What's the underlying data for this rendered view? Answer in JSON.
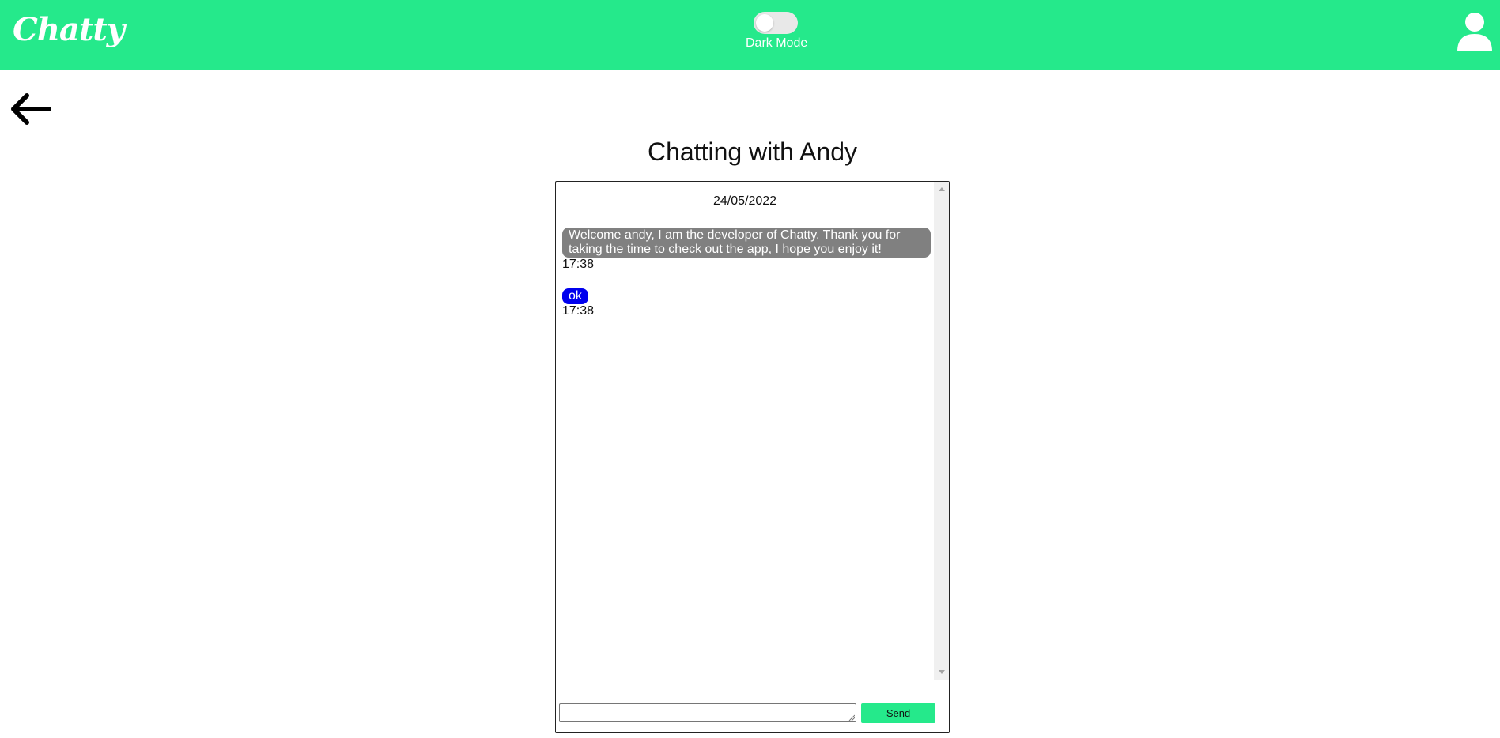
{
  "header": {
    "logo": "Chatty",
    "dark_mode_label": "Dark Mode",
    "dark_mode_on": false,
    "brand_color": "#25e98b",
    "user_icon": "user-icon"
  },
  "nav": {
    "back_icon": "arrow-left-icon"
  },
  "chat": {
    "title": "Chatting with Andy",
    "date": "24/05/2022",
    "messages": [
      {
        "text": "Welcome andy, I am the developer of Chatty. Thank you for taking the time to check out the app, I hope you enjoy it!",
        "time": "17:38",
        "bubble_color": "#808080"
      },
      {
        "text": "ok",
        "time": "17:38",
        "bubble_color": "#0000ee"
      }
    ],
    "composer": {
      "input_value": "",
      "send_label": "Send"
    }
  }
}
